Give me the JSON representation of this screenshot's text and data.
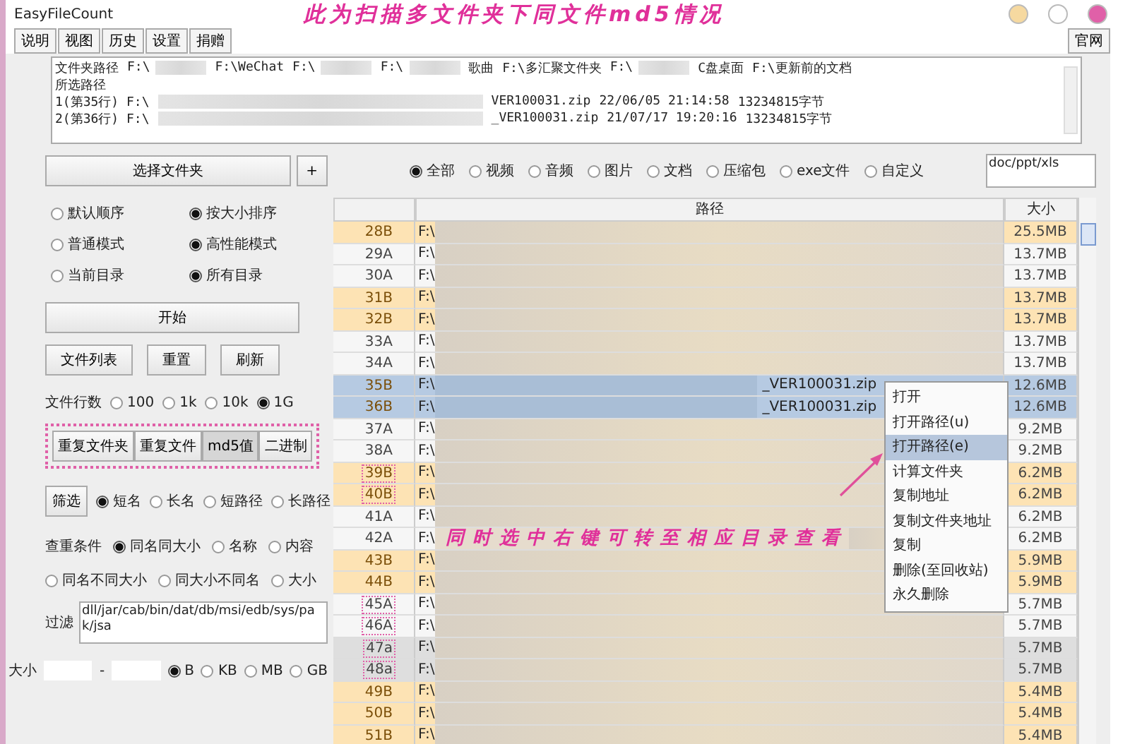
{
  "window": {
    "title": "EasyFileCount",
    "controls": [
      {
        "color": "#f6d9a0"
      },
      {
        "color": "#ffffff"
      },
      {
        "color": "#e060a8"
      }
    ]
  },
  "annotation_title": "此为扫描多文件夹下同文件md5情况",
  "menu": [
    "说明",
    "视图",
    "历史",
    "设置",
    "捐赠"
  ],
  "website_button": "官网",
  "log": {
    "folders_label": "文件夹路径",
    "folders": [
      {
        "text": "F:\\",
        "redacted": true
      },
      {
        "text": "F:\\WeChat",
        "redacted": false
      },
      {
        "text": "F:\\",
        "redacted": true
      },
      {
        "text": "F:\\",
        "redacted": true
      },
      {
        "text": "歌曲",
        "redacted": false
      },
      {
        "text": "F:\\多汇聚文件夹",
        "redacted": false
      },
      {
        "text": "F:\\",
        "redacted": true
      },
      {
        "text": "C盘桌面",
        "redacted": false
      },
      {
        "text": "F:\\更新前的文档",
        "redacted": false
      }
    ],
    "selected_label": "所选路径",
    "entries": [
      {
        "index": "1(第35行) F:\\",
        "file": "VER100031.zip",
        "time": "22/06/05 21:14:58",
        "size": "13234815字节"
      },
      {
        "index": "2(第36行) F:\\",
        "file": "_VER100031.zip",
        "time": "21/07/17 19:20:16",
        "size": "13234815字节"
      }
    ]
  },
  "choose_folder": "选择文件夹",
  "add_button": "+",
  "sort_options": [
    {
      "items": [
        {
          "label": "默认顺序",
          "selected": false
        },
        {
          "label": "按大小排序",
          "selected": true
        }
      ]
    },
    {
      "items": [
        {
          "label": "普通模式",
          "selected": false
        },
        {
          "label": "高性能模式",
          "selected": true
        }
      ]
    },
    {
      "items": [
        {
          "label": "当前目录",
          "selected": false
        },
        {
          "label": "所有目录",
          "selected": true
        }
      ]
    }
  ],
  "start_button": "开始",
  "list_buttons": [
    "文件列表",
    "重置",
    "刷新"
  ],
  "line_count": {
    "label": "文件行数",
    "options": [
      {
        "label": "100",
        "selected": false
      },
      {
        "label": "1k",
        "selected": false
      },
      {
        "label": "10k",
        "selected": false
      },
      {
        "label": "1G",
        "selected": true
      }
    ]
  },
  "mode_buttons": {
    "outlined": true,
    "items": [
      {
        "label": "重复文件夹",
        "selected": false
      },
      {
        "label": "重复文件",
        "selected": false
      },
      {
        "label": "md5值",
        "selected": true
      },
      {
        "label": "二进制",
        "selected": false
      }
    ]
  },
  "filter": {
    "button": "筛选",
    "options": [
      {
        "label": "短名",
        "selected": true
      },
      {
        "label": "长名",
        "selected": false
      },
      {
        "label": "短路径",
        "selected": false
      },
      {
        "label": "长路径",
        "selected": false
      }
    ]
  },
  "criteria": {
    "label": "查重条件",
    "options": [
      {
        "label": "同名同大小",
        "selected": true
      },
      {
        "label": "名称",
        "selected": false
      },
      {
        "label": "内容",
        "selected": false
      },
      {
        "label": "同名不同大小",
        "selected": false
      },
      {
        "label": "同大小不同名",
        "selected": false
      },
      {
        "label": "大小",
        "selected": false
      }
    ]
  },
  "exclude": {
    "label": "过滤",
    "value": "dll/jar/cab/bin/dat/db/msi/edb/sys/pak/jsa"
  },
  "size_filter": {
    "label": "大小",
    "separator": "-",
    "units": [
      {
        "label": "B",
        "selected": true
      },
      {
        "label": "KB",
        "selected": false
      },
      {
        "label": "MB",
        "selected": false
      },
      {
        "label": "GB",
        "selected": false
      }
    ]
  },
  "types": [
    {
      "label": "全部",
      "selected": true
    },
    {
      "label": "视频",
      "selected": false
    },
    {
      "label": "音频",
      "selected": false
    },
    {
      "label": "图片",
      "selected": false
    },
    {
      "label": "文档",
      "selected": false
    },
    {
      "label": "压缩包",
      "selected": false
    },
    {
      "label": "exe文件",
      "selected": false
    },
    {
      "label": "自定义",
      "selected": false
    }
  ],
  "custom_types": "doc/ppt/xls",
  "table": {
    "columns": [
      "路径",
      "大小"
    ],
    "rows": [
      {
        "id": "28B",
        "kind": "B",
        "selected": false,
        "marked": false,
        "path": "F:\\",
        "size": "25.5MB"
      },
      {
        "id": "29A",
        "kind": "A",
        "selected": false,
        "marked": false,
        "path": "F:\\",
        "size": "13.7MB"
      },
      {
        "id": "30A",
        "kind": "A",
        "selected": false,
        "marked": false,
        "path": "F:\\",
        "size": "13.7MB"
      },
      {
        "id": "31B",
        "kind": "B",
        "selected": false,
        "marked": false,
        "path": "F:\\",
        "size": "13.7MB"
      },
      {
        "id": "32B",
        "kind": "B",
        "selected": false,
        "marked": false,
        "path": "F:\\",
        "size": "13.7MB"
      },
      {
        "id": "33A",
        "kind": "A",
        "selected": false,
        "marked": false,
        "path": "F:\\",
        "size": "13.7MB"
      },
      {
        "id": "34A",
        "kind": "A",
        "selected": false,
        "marked": false,
        "path": "F:\\",
        "size": "13.7MB"
      },
      {
        "id": "35B",
        "kind": "B",
        "selected": true,
        "marked": false,
        "path": "F:\\",
        "file": "_VER100031.zip",
        "size": "12.6MB"
      },
      {
        "id": "36B",
        "kind": "B",
        "selected": true,
        "marked": false,
        "path": "F:\\",
        "file": "_VER100031.zip",
        "size": "12.6MB"
      },
      {
        "id": "37A",
        "kind": "A",
        "selected": false,
        "marked": false,
        "path": "F:\\",
        "size": "9.2MB"
      },
      {
        "id": "38A",
        "kind": "A",
        "selected": false,
        "marked": false,
        "path": "F:\\",
        "size": "9.2MB"
      },
      {
        "id": "39B",
        "kind": "B",
        "selected": false,
        "marked": true,
        "path": "F:\\",
        "size": "6.2MB"
      },
      {
        "id": "40B",
        "kind": "B",
        "selected": false,
        "marked": true,
        "path": "F:\\",
        "size": "6.2MB"
      },
      {
        "id": "41A",
        "kind": "A",
        "selected": false,
        "marked": false,
        "path": "F:\\",
        "size": "6.2MB"
      },
      {
        "id": "42A",
        "kind": "A",
        "selected": false,
        "marked": false,
        "path": "F:\\",
        "size": "6.2MB"
      },
      {
        "id": "43B",
        "kind": "B",
        "selected": false,
        "marked": false,
        "path": "F:\\",
        "size": "5.9MB"
      },
      {
        "id": "44B",
        "kind": "B",
        "selected": false,
        "marked": false,
        "path": "F:\\",
        "size": "5.9MB"
      },
      {
        "id": "45A",
        "kind": "A",
        "selected": false,
        "marked": true,
        "path": "F:\\",
        "size": "5.7MB"
      },
      {
        "id": "46A",
        "kind": "A",
        "selected": false,
        "marked": true,
        "path": "F:\\",
        "size": "5.7MB"
      },
      {
        "id": "47a",
        "kind": "a",
        "selected": false,
        "marked": true,
        "path": "F:\\",
        "size": "5.7MB"
      },
      {
        "id": "48a",
        "kind": "a",
        "selected": false,
        "marked": true,
        "path": "F:\\",
        "size": "5.7MB"
      },
      {
        "id": "49B",
        "kind": "B",
        "selected": false,
        "marked": false,
        "path": "F:\\",
        "size": "5.4MB"
      },
      {
        "id": "50B",
        "kind": "B",
        "selected": false,
        "marked": false,
        "path": "F:\\",
        "size": "5.4MB"
      },
      {
        "id": "51B",
        "kind": "B",
        "selected": false,
        "marked": false,
        "path": "F:\\",
        "size": "5.4MB"
      }
    ]
  },
  "context_menu": [
    {
      "label": "打开",
      "selected": false
    },
    {
      "label": "打开路径(u)",
      "selected": false
    },
    {
      "label": "打开路径(e)",
      "selected": true
    },
    {
      "label": "计算文件夹",
      "selected": false
    },
    {
      "label": "复制地址",
      "selected": false
    },
    {
      "label": "复制文件夹地址",
      "selected": false
    },
    {
      "label": "复制",
      "selected": false
    },
    {
      "label": "删除(至回收站)",
      "selected": false
    },
    {
      "label": "永久删除",
      "selected": false
    }
  ],
  "annotation_note": "同时选中右键可转至相应目录查看"
}
